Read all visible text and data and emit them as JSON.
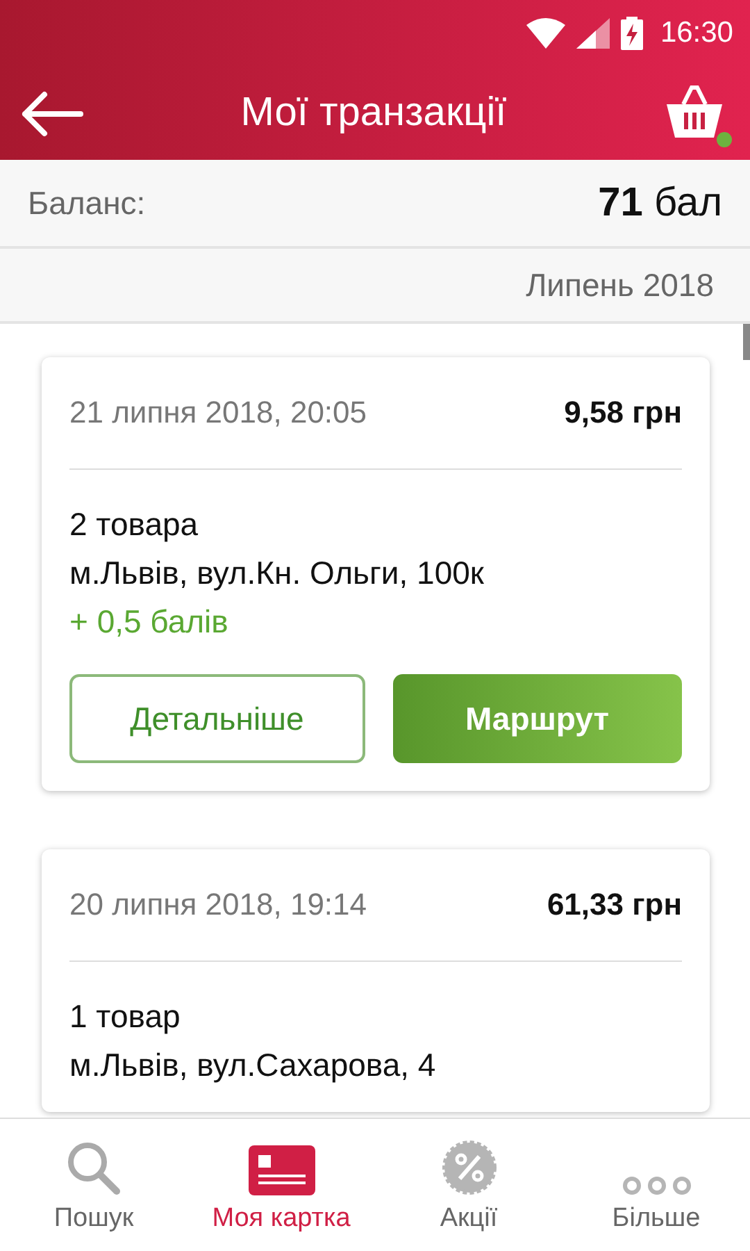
{
  "status_bar": {
    "time": "16:30"
  },
  "toolbar": {
    "title": "Мої транзакції",
    "cart_has_items": true
  },
  "balance": {
    "label": "Баланс:",
    "amount": "71",
    "unit": "бал"
  },
  "month": "Липень 2018",
  "transactions": [
    {
      "date": "21 липня 2018, 20:05",
      "sum": "9,58 грн",
      "items": "2 товара",
      "address": "м.Львів, вул.Кн. Ольги, 100к",
      "points": "+ 0,5 балів",
      "buttons": [
        "Детальніше",
        "Маршрут"
      ]
    },
    {
      "date": "20 липня 2018, 19:14",
      "sum": "61,33 грн",
      "items": "1 товар",
      "address": "м.Львів, вул.Сахарова, 4"
    }
  ],
  "bottom_nav": [
    {
      "label": "Пошук",
      "selected": false
    },
    {
      "label": "Моя картка",
      "selected": true
    },
    {
      "label": "Акції",
      "selected": false
    },
    {
      "label": "Більше",
      "selected": false
    }
  ]
}
